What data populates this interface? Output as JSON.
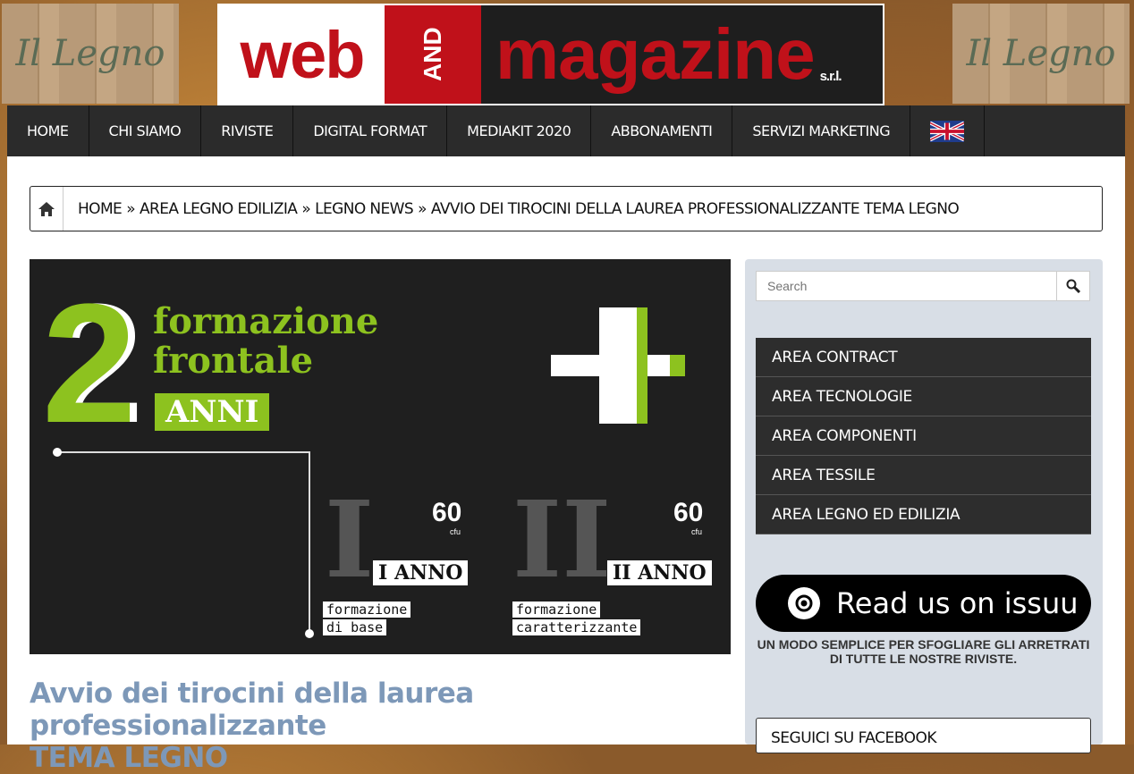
{
  "header": {
    "side_logo_text": "Il Legno",
    "logo_web": "web",
    "logo_and": "AND",
    "logo_magazine": "magazine",
    "logo_srl": "s.r.l."
  },
  "nav": {
    "items": [
      "HOME",
      "CHI SIAMO",
      "RIVISTE",
      "DIGITAL FORMAT",
      "MEDIAKIT 2020",
      "ABBONAMENTI",
      "SERVIZI MARKETING"
    ],
    "flag_icon": "uk-flag-icon"
  },
  "breadcrumb": {
    "home_icon": "home-icon",
    "items": [
      "HOME",
      "AREA LEGNO EDILIZIA",
      "LEGNO NEWS",
      "AVVIO DEI TIROCINI DELLA LAUREA PROFESSIONALIZZANTE TEMA LEGNO"
    ],
    "separator": "»"
  },
  "hero": {
    "big_number": "2",
    "line1": "formazione",
    "line2": "frontale",
    "anni": "ANNI",
    "roman1": "I",
    "roman2": "II",
    "cfu1": "60",
    "cfu2": "60",
    "cfu_label": "cfu",
    "anno1": "I ANNO",
    "anno2": "II ANNO",
    "sub1_line1": "formazione",
    "sub1_line2": "di base",
    "sub2_line1": "formazione",
    "sub2_line2": "caratterizzante",
    "accent_color": "#8dc21f"
  },
  "article": {
    "title_line1": "Avvio dei tirocini della laurea professionalizzante",
    "title_line2": "TEMA LEGNO",
    "title_color": "#7d98b8"
  },
  "sidebar": {
    "search_placeholder": "Search",
    "search_icon": "search-icon",
    "menu": [
      "AREA CONTRACT",
      "AREA TECNOLOGIE",
      "AREA COMPONENTI",
      "AREA TESSILE",
      "AREA LEGNO ED EDILIZIA"
    ],
    "issuu_label": "Read us on issuu",
    "issuu_caption": "UN MODO SEMPLICE PER SFOGLIARE GLI ARRETRATI DI TUTTE LE NOSTRE RIVISTE.",
    "facebook_title": "SEGUICI SU FACEBOOK"
  }
}
